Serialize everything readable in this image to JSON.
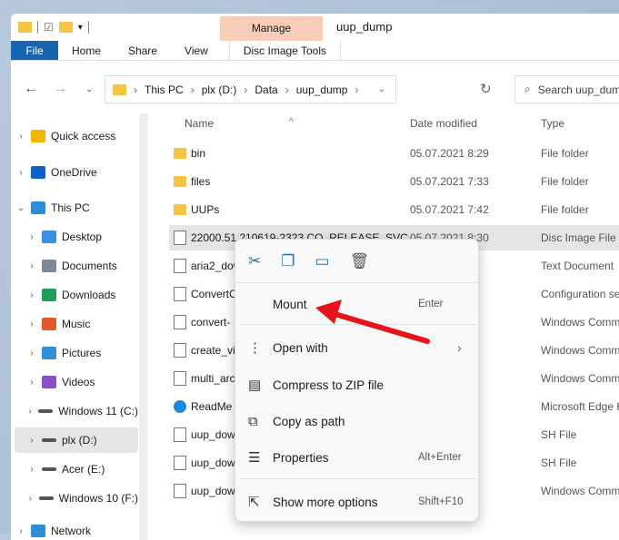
{
  "window": {
    "title": "uup_dump",
    "context_tab": "Manage"
  },
  "ribbon": {
    "tabs": [
      "File",
      "Home",
      "Share",
      "View"
    ],
    "context_tab_label": "Disc Image Tools"
  },
  "address": {
    "crumbs": [
      "This PC",
      "plx (D:)",
      "Data",
      "uup_dump"
    ]
  },
  "search": {
    "placeholder": "Search uup_dump"
  },
  "sidebar": {
    "items": [
      {
        "label": "Quick access",
        "icon": "star-icon",
        "color": "#f4b400",
        "level": 0
      },
      {
        "label": "OneDrive",
        "icon": "cloud-icon",
        "color": "#0a64c8",
        "level": 0
      },
      {
        "label": "This PC",
        "icon": "computer-icon",
        "color": "#2b8fd6",
        "level": 0,
        "expanded": true
      },
      {
        "label": "Desktop",
        "icon": "desktop-icon",
        "color": "#3a8ee6",
        "level": 1
      },
      {
        "label": "Documents",
        "icon": "documents-icon",
        "color": "#7a8a99",
        "level": 1
      },
      {
        "label": "Downloads",
        "icon": "download-icon",
        "color": "#1b9e5a",
        "level": 1
      },
      {
        "label": "Music",
        "icon": "music-icon",
        "color": "#e4572e",
        "level": 1
      },
      {
        "label": "Pictures",
        "icon": "pictures-icon",
        "color": "#2f8fdd",
        "level": 1
      },
      {
        "label": "Videos",
        "icon": "videos-icon",
        "color": "#8d4fc9",
        "level": 1
      },
      {
        "label": "Windows 11 (C:)",
        "icon": "drive-icon",
        "color": "#555555",
        "level": 1
      },
      {
        "label": "plx (D:)",
        "icon": "drive-icon",
        "color": "#555555",
        "level": 1,
        "selected": true
      },
      {
        "label": "Acer (E:)",
        "icon": "drive-icon",
        "color": "#555555",
        "level": 1
      },
      {
        "label": "Windows 10 (F:)",
        "icon": "drive-icon",
        "color": "#555555",
        "level": 1
      },
      {
        "label": "Network",
        "icon": "network-icon",
        "color": "#2b8fd6",
        "level": 0
      }
    ]
  },
  "columns": {
    "name": "Name",
    "date": "Date modified",
    "type": "Type"
  },
  "files": [
    {
      "name": "bin",
      "date": "05.07.2021 8:29",
      "type": "File folder",
      "icon": "folder-icon"
    },
    {
      "name": "files",
      "date": "05.07.2021 7:33",
      "type": "File folder",
      "icon": "folder-icon"
    },
    {
      "name": "UUPs",
      "date": "05.07.2021 7:42",
      "type": "File folder",
      "icon": "folder-icon"
    },
    {
      "name": "22000.51.210619-2323.CO_RELEASE_SVC",
      "date": "05.07.2021 8:30",
      "type": "Disc Image File",
      "icon": "disc-image-icon",
      "selected": true
    },
    {
      "name": "aria2_dow",
      "date": "",
      "type": "Text Document",
      "icon": "text-file-icon"
    },
    {
      "name": "ConvertC",
      "date": "",
      "type": "Configuration se",
      "icon": "config-file-icon"
    },
    {
      "name": "convert-",
      "date": "",
      "type": "Windows Comm",
      "icon": "cmd-file-icon"
    },
    {
      "name": "create_vi",
      "date": "",
      "type": "Windows Comm",
      "icon": "cmd-file-icon"
    },
    {
      "name": "multi_arc",
      "date": "",
      "type": "Windows Comm",
      "icon": "cmd-file-icon"
    },
    {
      "name": "ReadMe",
      "date": "",
      "type": "Microsoft Edge H",
      "icon": "edge-icon"
    },
    {
      "name": "uup_dow",
      "date": "",
      "type": "SH File",
      "icon": "file-icon"
    },
    {
      "name": "uup_dow",
      "date": "",
      "type": "SH File",
      "icon": "file-icon"
    },
    {
      "name": "uup_dow",
      "date": "",
      "type": "Windows Comm",
      "icon": "cmd-file-icon"
    }
  ],
  "context_menu": {
    "toolbar": [
      "cut-icon",
      "copy-icon",
      "rename-icon",
      "delete-icon"
    ],
    "items": [
      {
        "label": "Mount",
        "shortcut": "Enter",
        "icon": ""
      },
      {
        "label": "Open with",
        "shortcut": "",
        "icon": "open-with-icon",
        "submenu": true
      },
      {
        "label": "Compress to ZIP file",
        "shortcut": "",
        "icon": "zip-icon"
      },
      {
        "label": "Copy as path",
        "shortcut": "",
        "icon": "copy-path-icon"
      },
      {
        "label": "Properties",
        "shortcut": "Alt+Enter",
        "icon": "properties-icon"
      },
      {
        "label": "Show more options",
        "shortcut": "Shift+F10",
        "icon": "more-options-icon"
      }
    ]
  },
  "annotation": {
    "arrow_color": "#e8141b"
  }
}
